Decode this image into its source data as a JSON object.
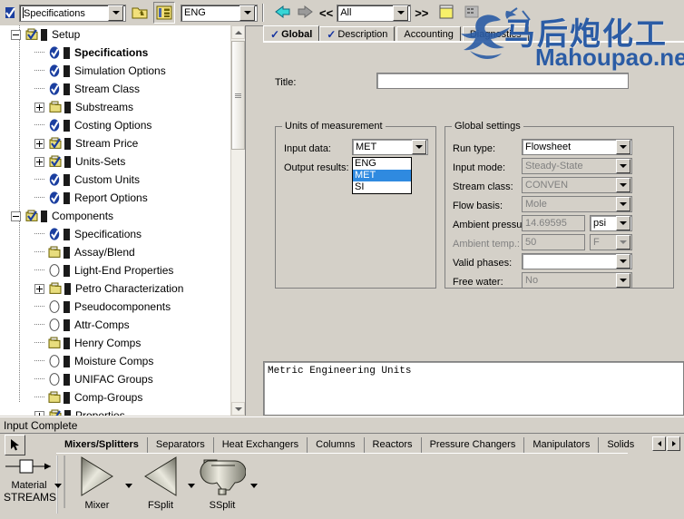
{
  "toolbar": {
    "spec_combo_value": "Specifications",
    "units_combo_value": "ENG",
    "nav_combo_value": "All",
    "back_icon": "back-arrow-icon",
    "forward_icon": "forward-arrow-icon",
    "prev_label": "<<",
    "next_label": ">>",
    "parent_folder_icon": "parent-folder-icon",
    "tree_view_icon": "tree-list-icon",
    "note_icon": "note-icon",
    "calculator_icon": "properties-icon",
    "check_icon": "blue-check-icon"
  },
  "tree": {
    "nodes": [
      {
        "label": "Setup",
        "level": 0,
        "expander": "minus",
        "icon": "folder-check-icon",
        "bold": false
      },
      {
        "label": "Specifications",
        "level": 1,
        "expander": "none",
        "icon": "check-circle-icon",
        "bold": true
      },
      {
        "label": "Simulation Options",
        "level": 1,
        "expander": "none",
        "icon": "check-circle-icon",
        "bold": false
      },
      {
        "label": "Stream Class",
        "level": 1,
        "expander": "none",
        "icon": "check-circle-icon",
        "bold": false
      },
      {
        "label": "Substreams",
        "level": 1,
        "expander": "plus",
        "icon": "folder-icon",
        "bold": false
      },
      {
        "label": "Costing Options",
        "level": 1,
        "expander": "none",
        "icon": "check-circle-icon",
        "bold": false
      },
      {
        "label": "Stream Price",
        "level": 1,
        "expander": "plus",
        "icon": "folder-check-icon",
        "bold": false
      },
      {
        "label": "Units-Sets",
        "level": 1,
        "expander": "plus",
        "icon": "folder-check-icon",
        "bold": false
      },
      {
        "label": "Custom Units",
        "level": 1,
        "expander": "none",
        "icon": "check-circle-icon",
        "bold": false
      },
      {
        "label": "Report Options",
        "level": 1,
        "expander": "none",
        "icon": "check-circle-icon",
        "bold": false
      },
      {
        "label": "Components",
        "level": 0,
        "expander": "minus",
        "icon": "folder-check-icon",
        "bold": false
      },
      {
        "label": "Specifications",
        "level": 1,
        "expander": "none",
        "icon": "check-circle-icon",
        "bold": false
      },
      {
        "label": "Assay/Blend",
        "level": 1,
        "expander": "none",
        "icon": "folder-icon",
        "bold": false
      },
      {
        "label": "Light-End Properties",
        "level": 1,
        "expander": "none",
        "icon": "empty-circle-icon",
        "bold": false
      },
      {
        "label": "Petro Characterization",
        "level": 1,
        "expander": "plus",
        "icon": "folder-icon",
        "bold": false
      },
      {
        "label": "Pseudocomponents",
        "level": 1,
        "expander": "none",
        "icon": "empty-circle-icon",
        "bold": false
      },
      {
        "label": "Attr-Comps",
        "level": 1,
        "expander": "none",
        "icon": "empty-circle-icon",
        "bold": false
      },
      {
        "label": "Henry Comps",
        "level": 1,
        "expander": "none",
        "icon": "folder-icon",
        "bold": false
      },
      {
        "label": "Moisture Comps",
        "level": 1,
        "expander": "none",
        "icon": "empty-circle-icon",
        "bold": false
      },
      {
        "label": "UNIFAC Groups",
        "level": 1,
        "expander": "none",
        "icon": "empty-circle-icon",
        "bold": false
      },
      {
        "label": "Comp-Groups",
        "level": 1,
        "expander": "none",
        "icon": "folder-icon",
        "bold": false
      },
      {
        "label": "Properties",
        "level": 1,
        "expander": "plus",
        "icon": "folder-check-icon",
        "bold": false
      }
    ]
  },
  "form": {
    "tabs": [
      {
        "label": "Global",
        "active": true,
        "check": true
      },
      {
        "label": "Description",
        "active": false,
        "check": true
      },
      {
        "label": "Accounting",
        "active": false,
        "check": false
      },
      {
        "label": "Diagnostics",
        "active": false,
        "check": false
      }
    ],
    "title_label": "Title:",
    "title_value": "",
    "units_group": {
      "legend": "Units of measurement",
      "input_label": "Input data:",
      "input_value": "MET",
      "output_label": "Output results:",
      "output_value": "",
      "dropdown_open": true,
      "dropdown_options": [
        "ENG",
        "MET",
        "SI"
      ],
      "dropdown_selected": "MET"
    },
    "global_group": {
      "legend": "Global settings",
      "rows": [
        {
          "label": "Run type:",
          "value": "Flowsheet",
          "disabled": false,
          "label_disabled": false,
          "unit": null,
          "unit_disabled": false
        },
        {
          "label": "Input mode:",
          "value": "Steady-State",
          "disabled": true,
          "label_disabled": false,
          "unit": null,
          "unit_disabled": false
        },
        {
          "label": "Stream class:",
          "value": "CONVEN",
          "disabled": true,
          "label_disabled": false,
          "unit": null,
          "unit_disabled": false
        },
        {
          "label": "Flow basis:",
          "value": "Mole",
          "disabled": true,
          "label_disabled": false,
          "unit": null,
          "unit_disabled": false
        },
        {
          "label": "Ambient pressure:",
          "value": "14.69595",
          "disabled": true,
          "label_disabled": false,
          "unit": "psi",
          "unit_disabled": false
        },
        {
          "label": "Ambient temp.:",
          "value": "50",
          "disabled": true,
          "label_disabled": true,
          "unit": "F",
          "unit_disabled": true
        },
        {
          "label": "Valid phases:",
          "value": "",
          "disabled": false,
          "label_disabled": false,
          "unit": null,
          "unit_disabled": false
        },
        {
          "label": "Free water:",
          "value": "No",
          "disabled": true,
          "label_disabled": false,
          "unit": null,
          "unit_disabled": false
        }
      ]
    }
  },
  "message_pane": {
    "text": "Metric Engineering Units"
  },
  "status": {
    "text": "Input Complete"
  },
  "model_library": {
    "select_tool_icon": "arrow-pointer-icon",
    "tabs": [
      {
        "label": "Mixers/Splitters",
        "active": true
      },
      {
        "label": "Separators",
        "active": false
      },
      {
        "label": "Heat Exchangers",
        "active": false
      },
      {
        "label": "Columns",
        "active": false
      },
      {
        "label": "Reactors",
        "active": false
      },
      {
        "label": "Pressure Changers",
        "active": false
      },
      {
        "label": "Manipulators",
        "active": false
      },
      {
        "label": "Solids",
        "active": false
      }
    ],
    "scroll_left_icon": "scroll-left-icon",
    "scroll_right_icon": "scroll-right-icon",
    "streams": {
      "label": "Material",
      "group_label": "STREAMS",
      "icon": "material-stream-icon"
    },
    "blocks": [
      {
        "label": "Mixer",
        "icon": "mixer-triangle-icon"
      },
      {
        "label": "FSplit",
        "icon": "fsplit-triangle-icon"
      },
      {
        "label": "SSplit",
        "icon": "ssplit-hopper-icon"
      }
    ]
  },
  "watermark": {
    "chinese": "马后炮化工",
    "english": "Mahoupao.net",
    "color": "#2b5ca5"
  },
  "colors": {
    "face": "#d4d0c8",
    "highlight": "#2f8ae0",
    "check_blue": "#1432a0"
  }
}
